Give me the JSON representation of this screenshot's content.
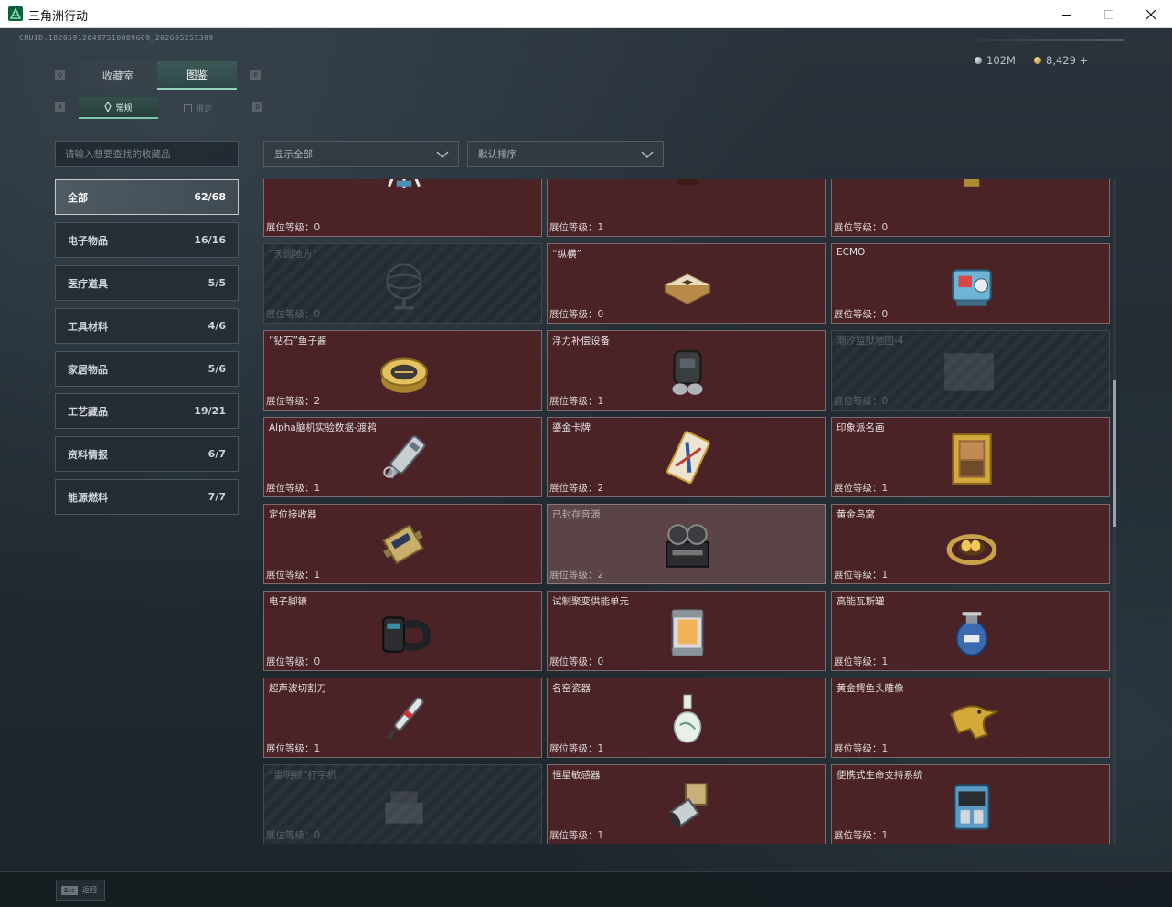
{
  "window": {
    "title": "三角洲行动"
  },
  "uid": "CNUID:182059120497510889669_202605251309",
  "currency": {
    "silver": "102M",
    "gold": "8,429 +"
  },
  "tabs": [
    {
      "label": "收藏室"
    },
    {
      "label": "图鉴"
    }
  ],
  "subtabs": [
    {
      "label": "常规"
    },
    {
      "label": "限定"
    }
  ],
  "search": {
    "placeholder": "请输入想要查找的收藏品"
  },
  "filters": {
    "show": "显示全部",
    "sort": "默认排序"
  },
  "categories": [
    {
      "label": "全部",
      "count": "62/68"
    },
    {
      "label": "电子物品",
      "count": "16/16"
    },
    {
      "label": "医疗道具",
      "count": "5/5"
    },
    {
      "label": "工具材料",
      "count": "4/6"
    },
    {
      "label": "家居物品",
      "count": "5/6"
    },
    {
      "label": "工艺藏品",
      "count": "19/21"
    },
    {
      "label": "资料情报",
      "count": "6/7"
    },
    {
      "label": "能源燃料",
      "count": "7/7"
    }
  ],
  "items": [
    {
      "name": "",
      "level": "展位等级：0",
      "icon": "robot-arm-icon"
    },
    {
      "name": "",
      "level": "展位等级：1",
      "icon": "gramophone-icon"
    },
    {
      "name": "",
      "level": "展位等级：0",
      "icon": "jeweled-egg-icon"
    },
    {
      "name": "“天圆地方”",
      "level": "展位等级：0",
      "icon": "armillary-sphere-icon"
    },
    {
      "name": "“纵横”",
      "level": "展位等级：0",
      "icon": "chess-box-icon"
    },
    {
      "name": "ECMO",
      "level": "展位等级：0",
      "icon": "ecmo-machine-icon"
    },
    {
      "name": "“钻石”鱼子酱",
      "level": "展位等级：2",
      "icon": "caviar-tin-icon"
    },
    {
      "name": "浮力补偿设备",
      "level": "展位等级：1",
      "icon": "buoyancy-device-icon"
    },
    {
      "name": "潮汐监狱地图-4",
      "level": "展位等级：0",
      "icon": "map-icon"
    },
    {
      "name": "Alpha脑机实验数据-渡鸦",
      "level": "展位等级：1",
      "icon": "data-drive-icon"
    },
    {
      "name": "鎏金卡牌",
      "level": "展位等级：2",
      "icon": "gilded-card-icon"
    },
    {
      "name": "印象派名画",
      "level": "展位等级：1",
      "icon": "framed-painting-icon"
    },
    {
      "name": "定位接收器",
      "level": "展位等级：1",
      "icon": "gps-receiver-icon"
    },
    {
      "name": "已封存音源",
      "level": "展位等级：2",
      "icon": "reel-recorder-icon"
    },
    {
      "name": "黄金鸟窝",
      "level": "展位等级：1",
      "icon": "golden-nest-icon"
    },
    {
      "name": "电子脚镣",
      "level": "展位等级：0",
      "icon": "ankle-monitor-icon"
    },
    {
      "name": "试制聚变供能单元",
      "level": "展位等级：0",
      "icon": "fusion-cell-icon"
    },
    {
      "name": "高能瓦斯罐",
      "level": "展位等级：1",
      "icon": "gas-canister-icon"
    },
    {
      "name": "超声波切割刀",
      "level": "展位等级：1",
      "icon": "ultrasonic-cutter-icon"
    },
    {
      "name": "名窑瓷器",
      "level": "展位等级：1",
      "icon": "porcelain-vase-icon"
    },
    {
      "name": "黄金鳄鱼头雕像",
      "level": "展位等级：1",
      "icon": "golden-crocodile-icon"
    },
    {
      "name": "“雷明顿”打字机",
      "level": "展位等级：0",
      "icon": "typewriter-icon"
    },
    {
      "name": "恒星敏感器",
      "level": "展位等级：1",
      "icon": "star-sensor-icon"
    },
    {
      "name": "便携式生命支持系统",
      "level": "展位等级：1",
      "icon": "life-support-icon"
    }
  ],
  "bottom": {
    "esc_key": "Esc",
    "esc_label": "返回"
  }
}
